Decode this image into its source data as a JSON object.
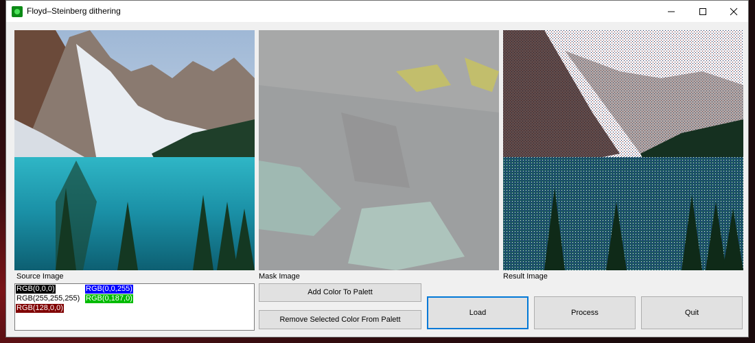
{
  "window": {
    "title": "Floyd–Steinberg dithering"
  },
  "images": {
    "source_label": "Source Image",
    "mask_label": "Mask Image",
    "result_label": "Result Image"
  },
  "palette": {
    "items": [
      {
        "label": "RGB(0,0,0)",
        "bg": "#000000",
        "fg": "#ffffff"
      },
      {
        "label": "RGB(0,0,255)",
        "bg": "#0000ff",
        "fg": "#ffffff"
      },
      {
        "label": "RGB(255,255,255)",
        "bg": "#ffffff",
        "fg": "#000000"
      },
      {
        "label": "RGB(0,187,0)",
        "bg": "#00bb00",
        "fg": "#ffffff"
      },
      {
        "label": "RGB(128,0,0)",
        "bg": "#800000",
        "fg": "#ffffff"
      }
    ]
  },
  "buttons": {
    "add_color": "Add Color To Palett",
    "remove_color": "Remove Selected Color From Palett",
    "load": "Load",
    "process": "Process",
    "quit": "Quit"
  },
  "colors": {
    "focus_border": "#0078d7",
    "window_bg": "#f0f0f0"
  }
}
